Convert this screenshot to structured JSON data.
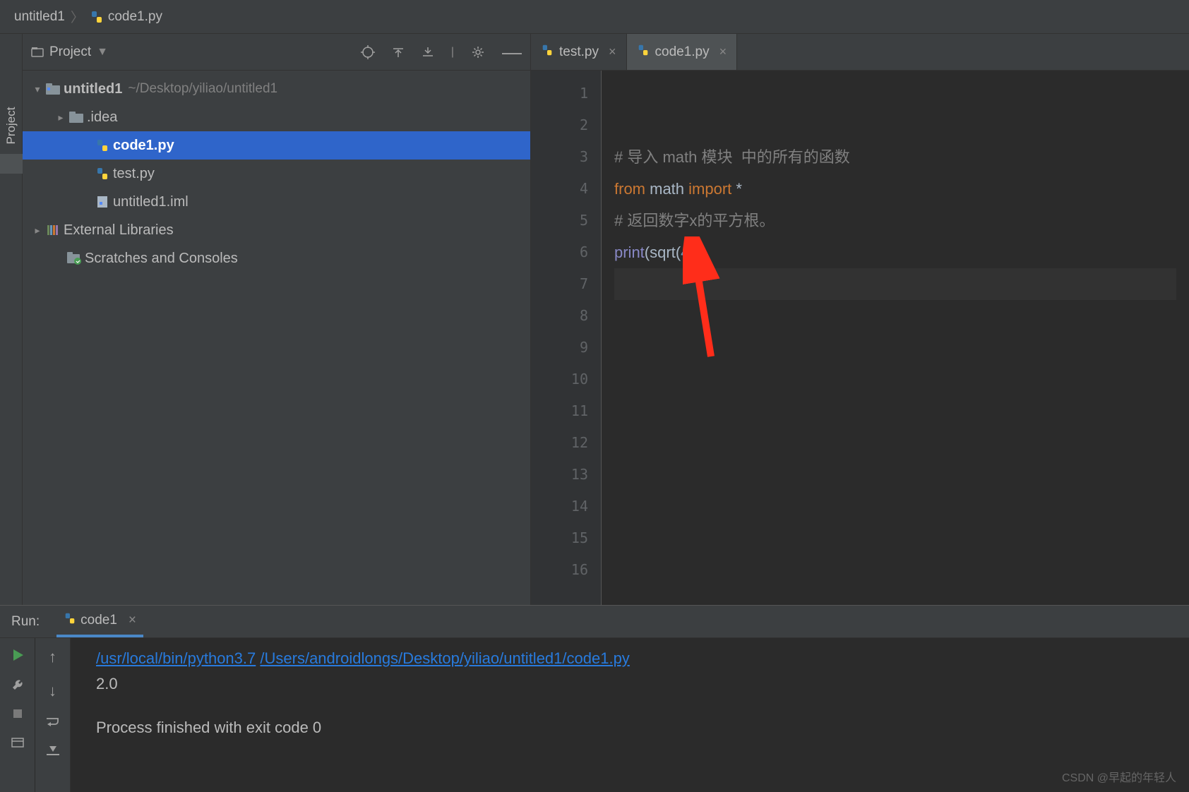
{
  "breadcrumb": {
    "root": "untitled1",
    "file": "code1.py"
  },
  "project_panel": {
    "title": "Project",
    "items": {
      "root_name": "untitled1",
      "root_path": "~/Desktop/yiliao/untitled1",
      "idea": ".idea",
      "code1": "code1.py",
      "test": "test.py",
      "iml": "untitled1.iml",
      "ext": "External Libraries",
      "scratch": "Scratches and Consoles"
    }
  },
  "tabs": [
    {
      "label": "test.py",
      "active": false
    },
    {
      "label": "code1.py",
      "active": true
    }
  ],
  "sidebar_tab": "Project",
  "editor": {
    "comment1": "# 导入 math 模块  中的所有的函数",
    "kw_from": "from",
    "mod": "math",
    "kw_import": "import",
    "star": "*",
    "comment2": "# 返回数字x的平方根。",
    "print": "print",
    "sqrt": "sqrt",
    "arg": "4",
    "line_numbers": [
      "1",
      "2",
      "3",
      "4",
      "5",
      "6",
      "7",
      "8",
      "9",
      "10",
      "11",
      "12",
      "13",
      "14",
      "15",
      "16"
    ]
  },
  "run": {
    "title": "Run:",
    "tab": "code1",
    "interpreter": "/usr/local/bin/python3.7",
    "script": "/Users/androidlongs/Desktop/yiliao/untitled1/code1.py",
    "output": "2.0",
    "exit": "Process finished with exit code 0"
  },
  "watermark": "CSDN @早起的年轻人"
}
